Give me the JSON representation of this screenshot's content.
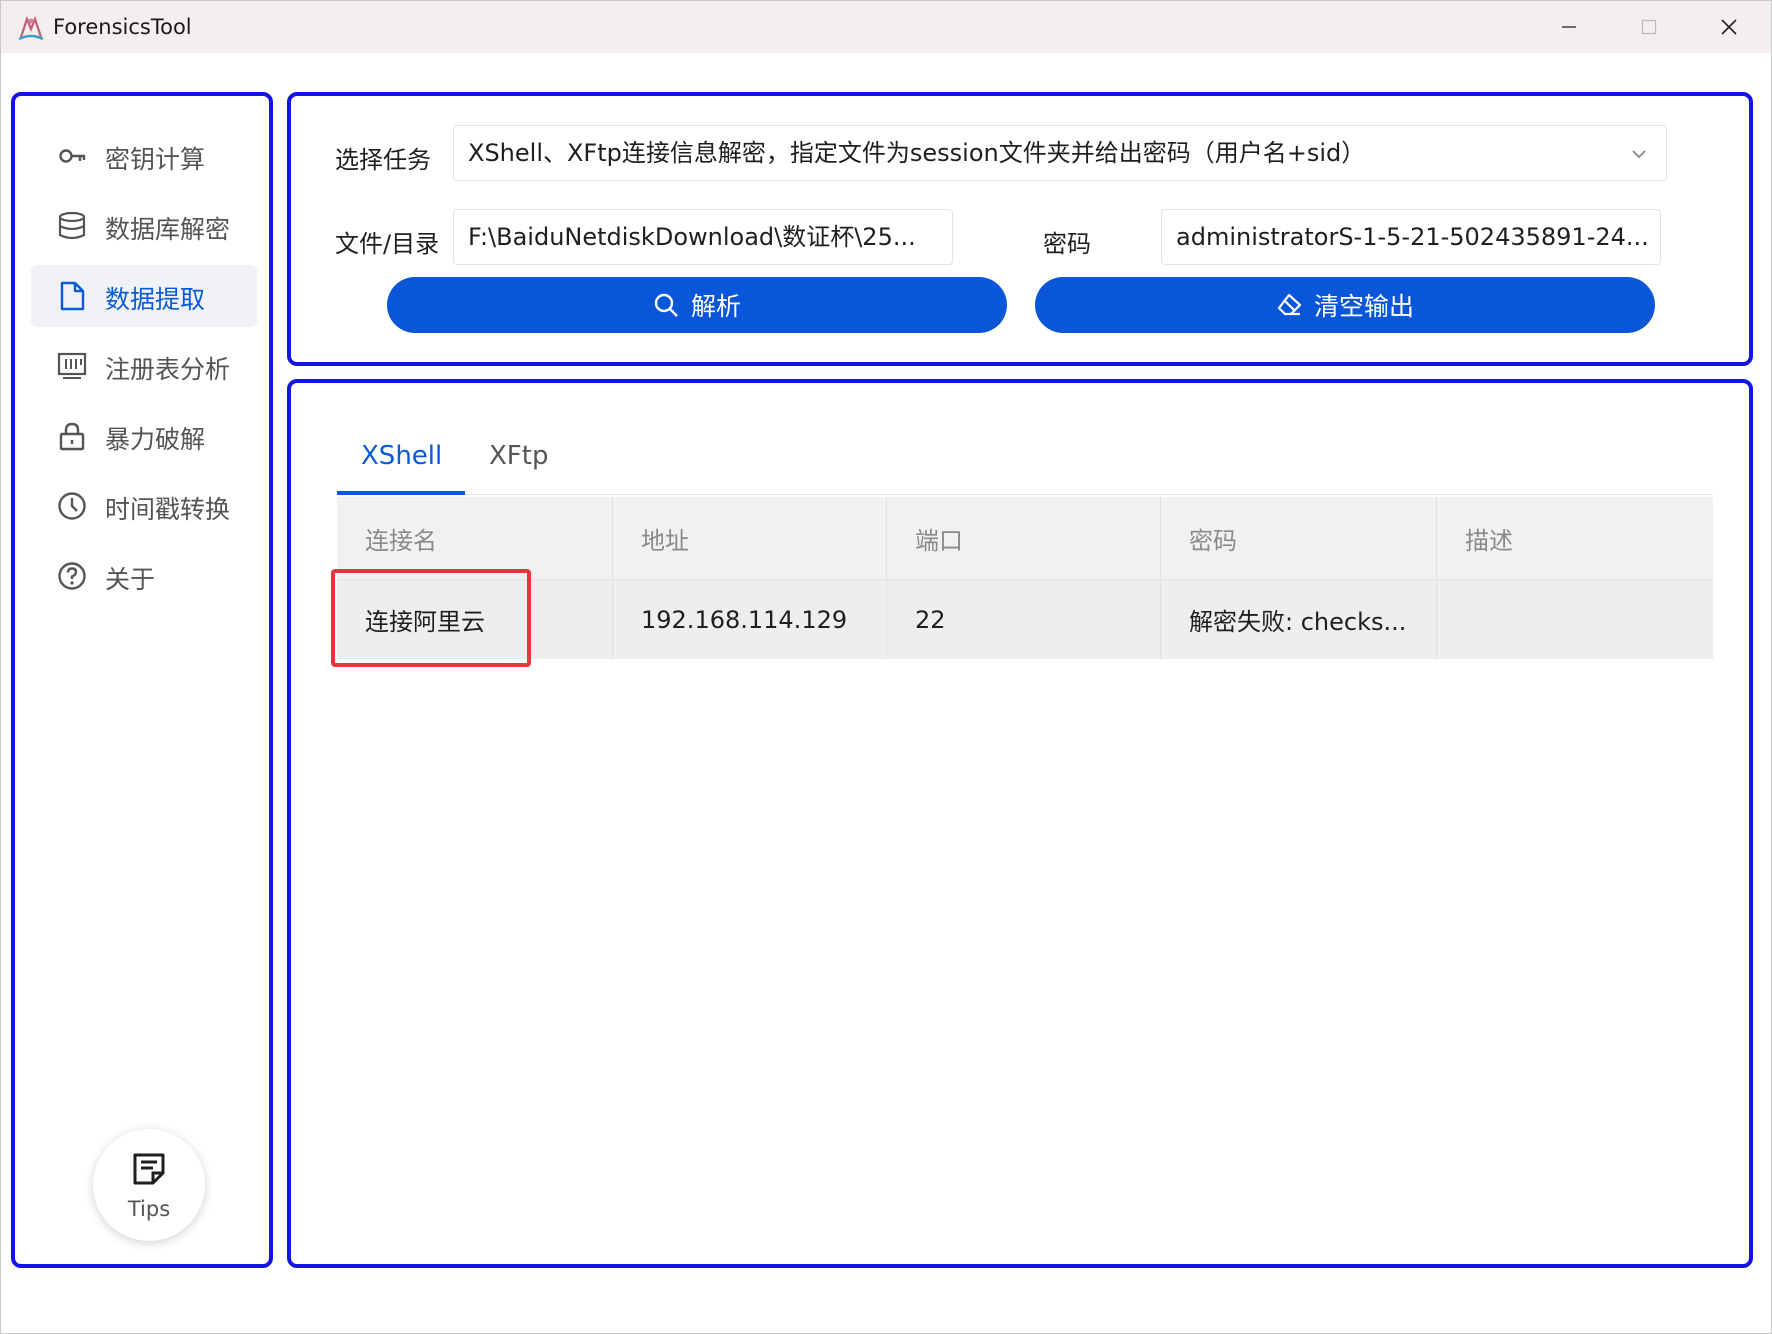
{
  "window": {
    "title": "ForensicsTool"
  },
  "sidebar": {
    "items": [
      {
        "label": "密钥计算",
        "icon": "key-icon",
        "active": false
      },
      {
        "label": "数据库解密",
        "icon": "database-icon",
        "active": false
      },
      {
        "label": "数据提取",
        "icon": "document-icon",
        "active": true
      },
      {
        "label": "注册表分析",
        "icon": "registry-icon",
        "active": false
      },
      {
        "label": "暴力破解",
        "icon": "lock-icon",
        "active": false
      },
      {
        "label": "时间戳转换",
        "icon": "clock-icon",
        "active": false
      },
      {
        "label": "关于",
        "icon": "help-icon",
        "active": false
      }
    ],
    "tips_label": "Tips"
  },
  "form": {
    "task_label": "选择任务",
    "task_value": "XShell、XFtp连接信息解密，指定文件为session文件夹并给出密码（用户名+sid）",
    "path_label": "文件/目录",
    "path_value": "F:\\BaiduNetdiskDownload\\数证杯\\25...",
    "password_label": "密码",
    "password_value": "administratorS-1-5-21-502435891-24...",
    "parse_button": "解析",
    "clear_button": "清空输出"
  },
  "tabs": [
    {
      "label": "XShell",
      "active": true
    },
    {
      "label": "XFtp",
      "active": false
    }
  ],
  "table": {
    "headers": [
      "连接名",
      "地址",
      "端口",
      "密码",
      "描述"
    ],
    "rows": [
      [
        "连接阿里云",
        "192.168.114.129",
        "22",
        "解密失败: checks...",
        ""
      ]
    ]
  },
  "colors": {
    "accent": "#0a56d9",
    "panel_border": "#1414e6",
    "highlight": "#e8353d"
  }
}
